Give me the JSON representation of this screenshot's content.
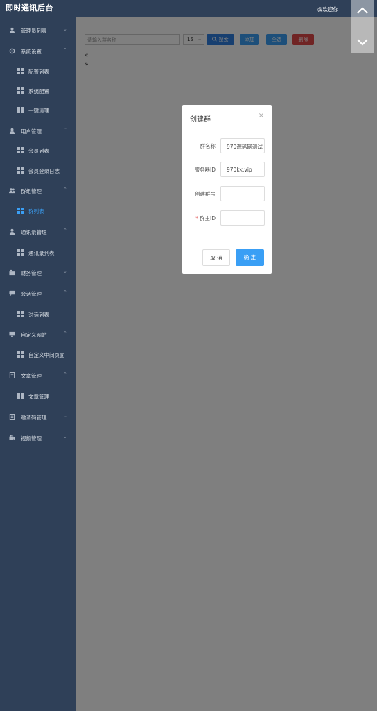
{
  "app": {
    "title": "即时通讯后台",
    "welcome": "@欢迎你"
  },
  "sidebar": {
    "items": [
      {
        "label": "管理员列表",
        "icon": "user-icon",
        "chevron": "v",
        "level": "top"
      },
      {
        "label": "系统设置",
        "icon": "gear-icon",
        "chevron": "^",
        "level": "top"
      },
      {
        "label": "配置列表",
        "icon": "grid-icon",
        "level": "sub"
      },
      {
        "label": "系统配置",
        "icon": "grid-icon",
        "level": "sub"
      },
      {
        "label": "一键清理",
        "icon": "grid-icon",
        "level": "sub"
      },
      {
        "label": "用户管理",
        "icon": "user-icon",
        "chevron": "^",
        "level": "top"
      },
      {
        "label": "会员列表",
        "icon": "grid-icon",
        "level": "sub"
      },
      {
        "label": "会员登录日志",
        "icon": "grid-icon",
        "level": "sub"
      },
      {
        "label": "群组管理",
        "icon": "group-icon",
        "chevron": "^",
        "level": "top"
      },
      {
        "label": "群列表",
        "icon": "grid-icon",
        "level": "sub",
        "active": true
      },
      {
        "label": "通讯录管理",
        "icon": "user-icon",
        "chevron": "^",
        "level": "top"
      },
      {
        "label": "通讯录列表",
        "icon": "grid-icon",
        "level": "sub"
      },
      {
        "label": "财务管理",
        "icon": "finance-icon",
        "chevron": "v",
        "level": "top"
      },
      {
        "label": "会话管理",
        "icon": "chat-icon",
        "chevron": "^",
        "level": "top"
      },
      {
        "label": "对话列表",
        "icon": "grid-icon",
        "level": "sub"
      },
      {
        "label": "自定义网站",
        "icon": "monitor-icon",
        "chevron": "^",
        "level": "top"
      },
      {
        "label": "自定义中间页面",
        "icon": "grid-icon",
        "level": "sub"
      },
      {
        "label": "文章管理",
        "icon": "document-icon",
        "chevron": "^",
        "level": "top"
      },
      {
        "label": "文章管理",
        "icon": "grid-icon",
        "level": "sub"
      },
      {
        "label": "邀请码管理",
        "icon": "document-icon",
        "chevron": "v",
        "level": "top"
      },
      {
        "label": "视频管理",
        "icon": "video-icon",
        "chevron": "v",
        "level": "top"
      }
    ]
  },
  "toolbar": {
    "search_placeholder": "请输入群名称",
    "page_size": "15",
    "search_label": "搜索",
    "add_label": "添加",
    "select_all_label": "全选",
    "delete_label": "删除"
  },
  "pager": {
    "prev": "«",
    "next": "»"
  },
  "modal": {
    "title": "创建群",
    "close": "×",
    "fields": [
      {
        "label": "群名称",
        "value": "970源码网测试",
        "required": false
      },
      {
        "label": "服务器ID",
        "value": "970kk.vip",
        "required": false
      },
      {
        "label": "创建群号",
        "value": "",
        "required": false
      },
      {
        "label": "群主ID",
        "value": "",
        "required": true,
        "req_mark": "*"
      }
    ],
    "cancel_label": "取 消",
    "ok_label": "确 定"
  },
  "colors": {
    "sidebar_bg": "#2f4058",
    "accent": "#3a9ff5",
    "danger": "#e04848",
    "overlay": "rgba(0,0,0,0.5)"
  }
}
